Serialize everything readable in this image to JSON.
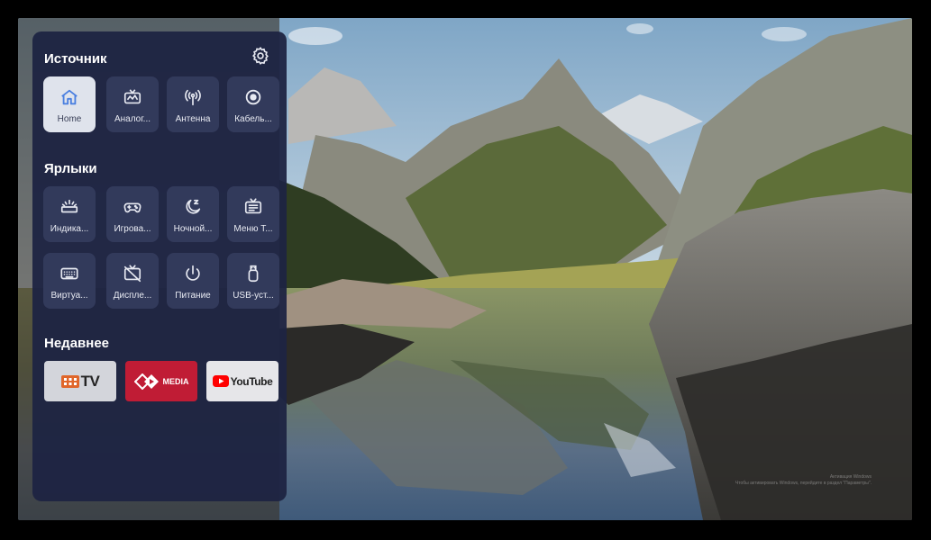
{
  "source": {
    "title": "Источник",
    "settings_icon": "gear-icon",
    "items": [
      {
        "label": "Home",
        "icon": "home-icon",
        "active": true
      },
      {
        "label": "Аналог...",
        "icon": "analog-tv-icon"
      },
      {
        "label": "Антенна",
        "icon": "antenna-icon"
      },
      {
        "label": "Кабель...",
        "icon": "cable-icon"
      }
    ]
  },
  "shortcuts": {
    "title": "Ярлыки",
    "items": [
      {
        "label": "Индика...",
        "icon": "indicator-icon"
      },
      {
        "label": "Игрова...",
        "icon": "gamepad-icon"
      },
      {
        "label": "Ночной...",
        "icon": "night-mode-icon"
      },
      {
        "label": "Меню Т...",
        "icon": "tv-menu-icon"
      },
      {
        "label": "Виртуа...",
        "icon": "keyboard-icon"
      },
      {
        "label": "Диспле...",
        "icon": "display-off-icon"
      },
      {
        "label": "Питание",
        "icon": "power-icon"
      },
      {
        "label": "USB-уст...",
        "icon": "usb-icon"
      }
    ]
  },
  "recent": {
    "title": "Недавнее",
    "apps": [
      {
        "name": "TV",
        "icon": "tv-app-logo"
      },
      {
        "name": "MEDIA",
        "icon": "media-app-logo"
      },
      {
        "name": "YouTube",
        "icon": "youtube-logo"
      }
    ]
  },
  "watermark": {
    "line1": "Активация Windows",
    "line2": "Чтобы активировать Windows, перейдите в раздел \"Параметры\"."
  },
  "colors": {
    "panel": "#1e2442",
    "tile": "#343b5d",
    "active_tile": "#dfe3ec",
    "active_icon": "#4a7fe0",
    "media_red": "#c01c35",
    "youtube_red": "#ff0000"
  }
}
